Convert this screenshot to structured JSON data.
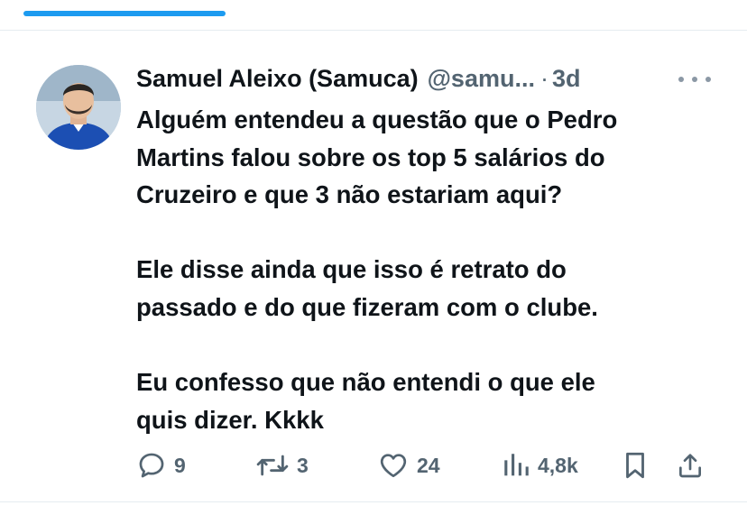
{
  "top_progress": {
    "fraction": 0.27,
    "color": "#1d9bf0"
  },
  "tweet": {
    "display_name": "Samuel Aleixo (Samuca)",
    "handle": "@samu...",
    "separator": "·",
    "time": "3d",
    "paragraph_1_lines": [
      "Alguém entendeu a questão que o Pedro",
      "Martins falou sobre os top 5 salários do",
      "Cruzeiro e que 3 não estariam aqui?"
    ],
    "paragraph_2_lines": [
      "Ele disse ainda que isso é retrato do",
      "passado e do que fizeram com o clube."
    ],
    "paragraph_3_lines": [
      "Eu confesso que não entendi o que ele",
      "quis dizer. Kkkk"
    ]
  },
  "actions": {
    "replies": "9",
    "retweets": "3",
    "likes": "24",
    "views": "4,8k"
  },
  "icons": [
    "more-icon",
    "reply-icon",
    "retweet-icon",
    "like-icon",
    "views-icon",
    "bookmark-icon",
    "share-icon"
  ],
  "colors": {
    "text": "#0f1419",
    "secondary": "#536471",
    "accent": "#1d9bf0"
  }
}
